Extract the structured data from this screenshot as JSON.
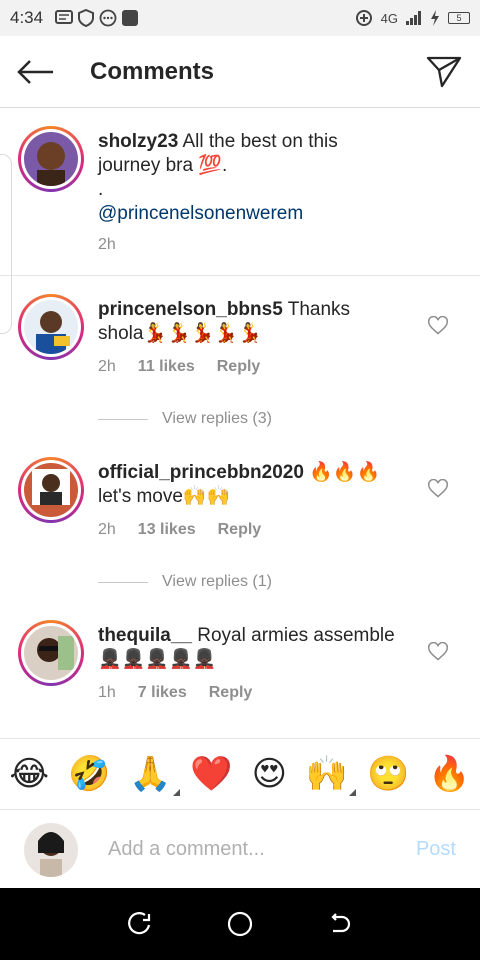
{
  "status_bar": {
    "time": "4:34",
    "network": "4G",
    "battery": "5"
  },
  "header": {
    "title": "Comments",
    "back_icon": "arrow-left-icon",
    "send_icon": "paper-plane-icon"
  },
  "comments": [
    {
      "username": "sholzy23",
      "text": "All the best on this journey bra 💯.",
      "extra_line": ".",
      "mention": "@princenelsonenwerem",
      "time": "2h"
    },
    {
      "username": "princenelson_bbns5",
      "text": "Thanks shola💃💃💃💃💃",
      "time": "2h",
      "likes": "11 likes",
      "reply": "Reply",
      "view_replies": "View replies (3)"
    },
    {
      "username": "official_princebbn2020",
      "text": "🔥🔥🔥 let's move🙌🙌",
      "time": "2h",
      "likes": "13 likes",
      "reply": "Reply",
      "view_replies": "View replies (1)"
    },
    {
      "username": "thequila__",
      "text": "Royal armies assemble 💂🏿‍♂️💂🏿‍♂️💂🏿‍♂️💂🏿‍♂️💂🏿‍♂️",
      "time": "1h",
      "likes": "7 likes",
      "reply": "Reply"
    }
  ],
  "emoji_bar": [
    "😂",
    "🤣",
    "🙏",
    "❤️",
    "😍",
    "🙌",
    "🙄",
    "🔥"
  ],
  "add_comment": {
    "placeholder": "Add a comment...",
    "post_label": "Post"
  },
  "colors": {
    "mention": "#00376b",
    "post_disabled": "#b3dbff",
    "meta_gray": "#8e8e8e"
  }
}
